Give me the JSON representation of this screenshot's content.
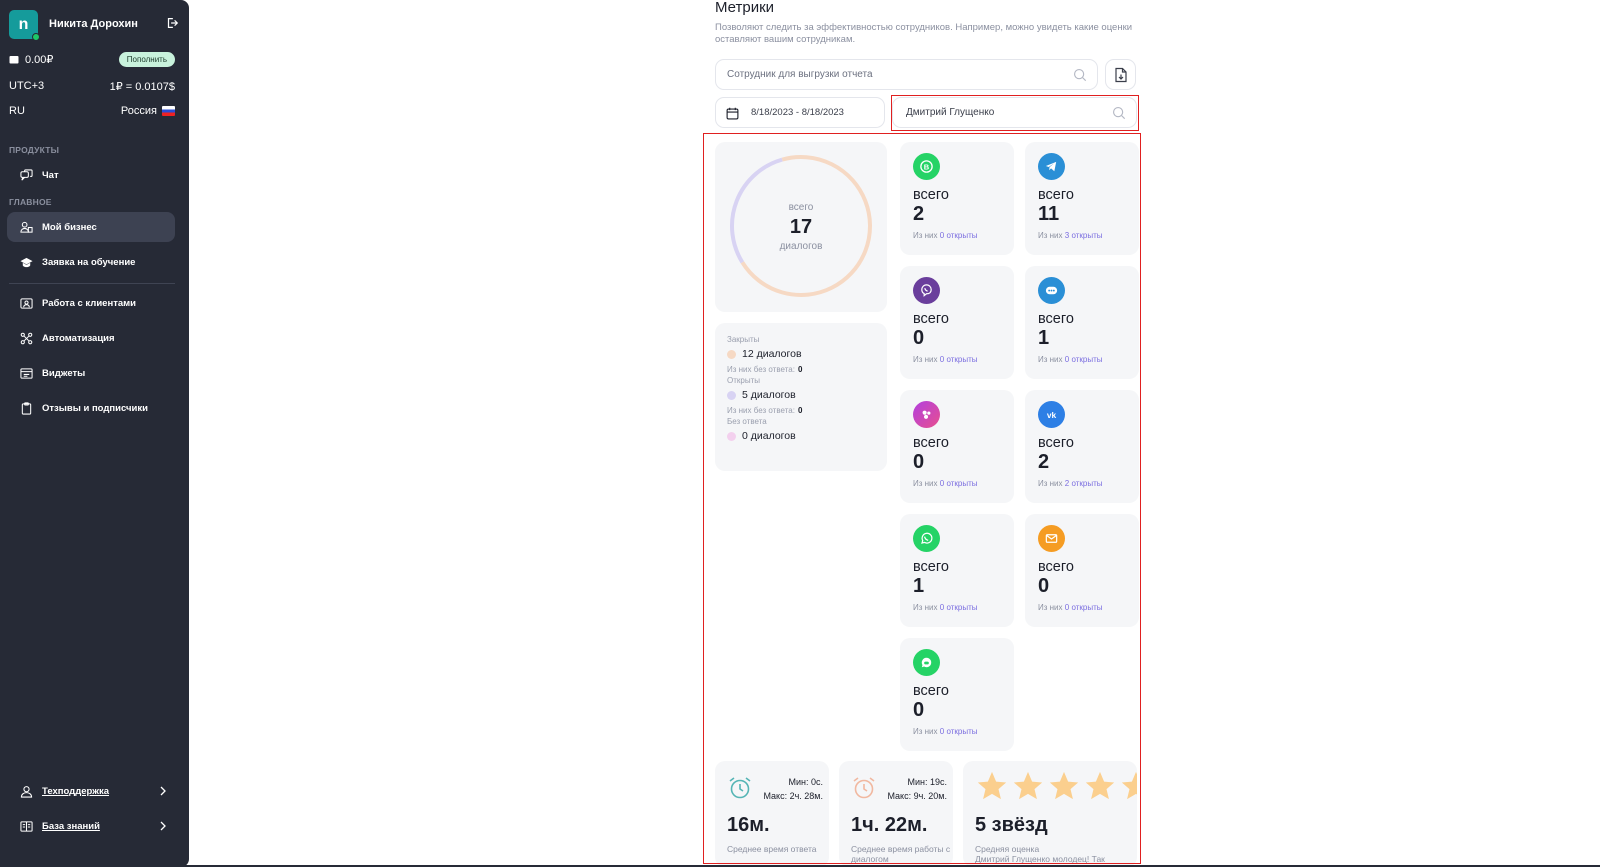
{
  "sidebar": {
    "avatar_letter": "n",
    "user_name": "Никита Дорохин",
    "balance": "0.00₽",
    "topup_label": "Пополнить",
    "timezone": "UTC+3",
    "rate": "1₽ = 0.0107$",
    "lang": "RU",
    "country": "Россия",
    "products_label": "ПРОДУКТЫ",
    "main_label": "ГЛАВНОЕ",
    "items": {
      "chat": "Чат",
      "business": "Мой бизнес",
      "training": "Заявка на обучение",
      "clients": "Работа с клиентами",
      "automation": "Автоматизация",
      "widgets": "Виджеты",
      "reviews": "Отзывы и подписчики",
      "support": "Техподдержка",
      "knowledge": "База знаний"
    }
  },
  "main": {
    "title": "Метрики",
    "subtitle": "Позволяют следить за эффективностью сотрудников. Например, можно увидеть какие оценки оставляют вашим сотрудникам.",
    "employee_search_placeholder": "Сотрудник для выгрузки отчета",
    "date_range": "8/18/2023 - 8/18/2023",
    "employee_value": "Дмитрий Глущенко",
    "donut": {
      "top": "всего",
      "number": "17",
      "bottom": "диалогов"
    },
    "chart_data": {
      "type": "pie",
      "categories": [
        "Закрыты",
        "Открыты",
        "Без ответа"
      ],
      "values": [
        12,
        5,
        0
      ],
      "colors": [
        "#f6d9c4",
        "#d8d3f3",
        "#f3d0ee"
      ]
    },
    "legend": {
      "closed_cap": "Закрыты",
      "closed_val": "12 диалогов",
      "closed_note": "Из них без ответа:",
      "closed_note_val": "0",
      "open_cap": "Открыты",
      "open_val": "5 диалогов",
      "open_note": "Из них без ответа:",
      "open_note_val": "0",
      "noreply_cap": "Без ответа",
      "noreply_val": "0 диалогов"
    },
    "channel_label": "всего",
    "note_prefix": "Из них",
    "note_suffix": "открыты",
    "channels": [
      {
        "icon": "v-badge-icon",
        "total": "2",
        "open": "0"
      },
      {
        "icon": "telegram-icon",
        "total": "11",
        "open": "3"
      },
      {
        "icon": "viber-icon",
        "total": "0",
        "open": "0"
      },
      {
        "icon": "chat-bubble-icon",
        "total": "1",
        "open": "0"
      },
      {
        "icon": "instagram-icon",
        "total": "0",
        "open": "0"
      },
      {
        "icon": "vk-icon",
        "total": "2",
        "open": "2"
      },
      {
        "icon": "whatsapp-icon",
        "total": "1",
        "open": "0"
      },
      {
        "icon": "email-icon",
        "total": "0",
        "open": "0"
      },
      {
        "icon": "chat-circle-icon",
        "total": "0",
        "open": "0"
      }
    ],
    "stats": [
      {
        "min": "Мин: 0с.",
        "max": "Макс: 2ч. 28м.",
        "value": "16м.",
        "caption": "Среднее время ответа"
      },
      {
        "min": "Мин: 19с.",
        "max": "Макс: 9ч. 20м.",
        "value": "1ч. 22м.",
        "caption": "Среднее время работы с диалогом"
      }
    ],
    "rating": {
      "value": "5 звёзд",
      "caption": "Средняя оценка",
      "comment": "Дмитрий Глущенко молодец! Так держать!"
    },
    "colors": {
      "whatsapp": "#25d366",
      "telegram": "#2a8fd6",
      "viber": "#6a3e9c",
      "vk": "#2d7fe5",
      "email": "#f59c23",
      "highlight": "#e02020"
    }
  }
}
